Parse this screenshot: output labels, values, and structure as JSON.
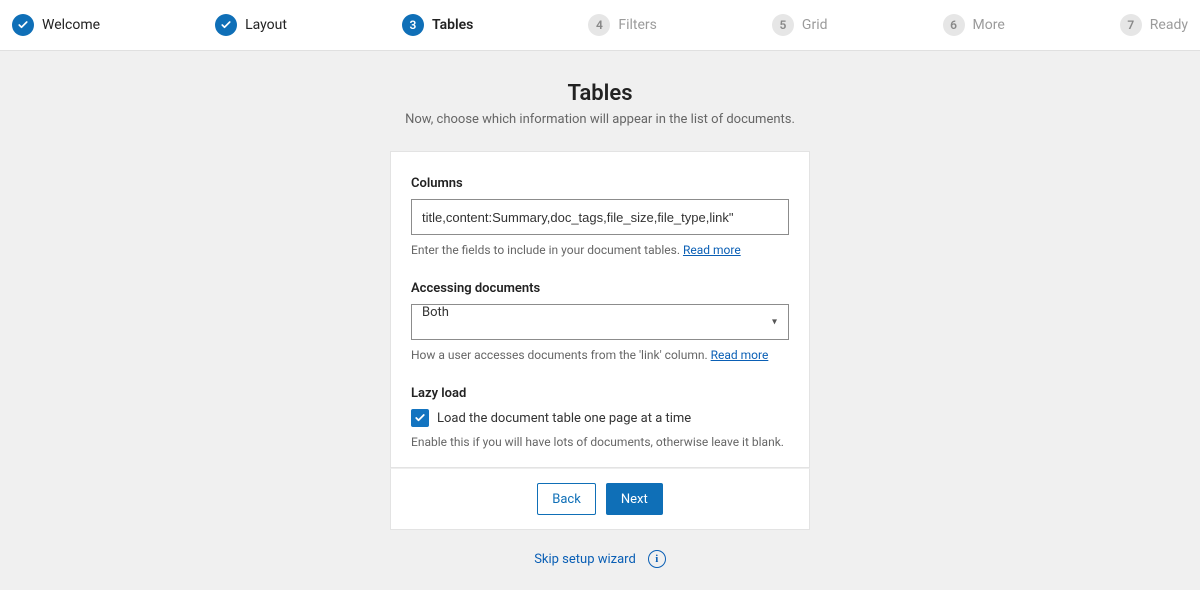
{
  "stepper": {
    "steps": [
      {
        "bullet": "check",
        "label": "Welcome",
        "state": "done"
      },
      {
        "bullet": "check",
        "label": "Layout",
        "state": "done"
      },
      {
        "bullet": "3",
        "label": "Tables",
        "state": "active"
      },
      {
        "bullet": "4",
        "label": "Filters",
        "state": "upcoming"
      },
      {
        "bullet": "5",
        "label": "Grid",
        "state": "upcoming"
      },
      {
        "bullet": "6",
        "label": "More",
        "state": "upcoming"
      },
      {
        "bullet": "7",
        "label": "Ready",
        "state": "upcoming"
      }
    ]
  },
  "header": {
    "title": "Tables",
    "subtitle": "Now, choose which information will appear in the list of documents."
  },
  "fields": {
    "columns": {
      "label": "Columns",
      "value": "title,content:Summary,doc_tags,file_size,file_type,link\"",
      "help": "Enter the fields to include in your document tables. ",
      "help_link": "Read more"
    },
    "accessing": {
      "label": "Accessing documents",
      "value": "Both",
      "help": "How a user accesses documents from the 'link' column. ",
      "help_link": "Read more"
    },
    "lazyload": {
      "label": "Lazy load",
      "checkbox_label": "Load the document table one page at a time",
      "checked": true,
      "help": "Enable this if you will have lots of documents, otherwise leave it blank."
    }
  },
  "buttons": {
    "back": "Back",
    "next": "Next"
  },
  "footer": {
    "skip": "Skip setup wizard"
  }
}
